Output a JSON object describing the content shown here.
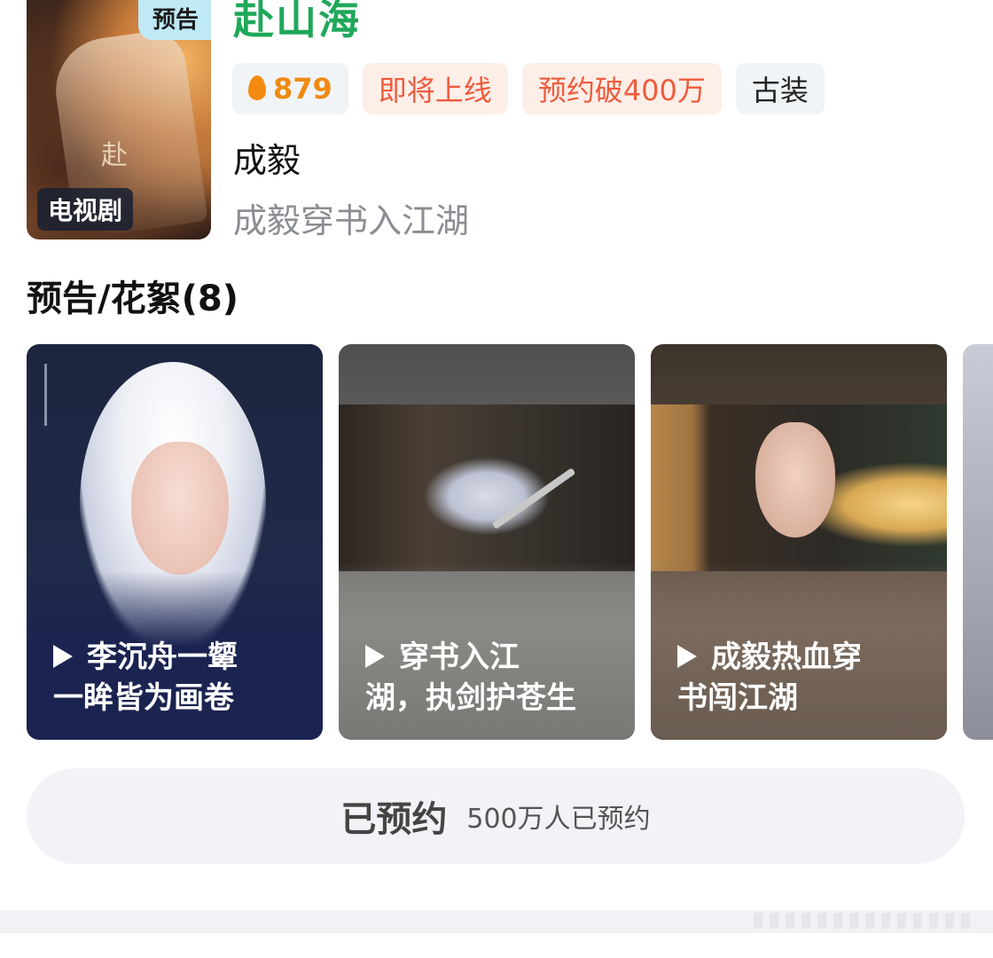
{
  "show": {
    "title": "赴山海",
    "poster_badge": "预告",
    "poster_type": "电视剧",
    "hot_value": "879",
    "tags": [
      "即将上线",
      "预约破400万",
      "古装"
    ],
    "actor": "成毅",
    "description": "成毅穿书入江湖"
  },
  "section": {
    "title": "预告/花絮(8)",
    "cards": [
      {
        "line1": "李沉舟一颦",
        "line2": "一眸皆为画卷"
      },
      {
        "line1": "穿书入江",
        "line2": "湖，执剑护苍生"
      },
      {
        "line1": "成毅热血穿",
        "line2": "书闯江湖"
      }
    ]
  },
  "reserve": {
    "label": "已预约",
    "count_text": "500万人已预约"
  },
  "colors": {
    "title_green": "#1fa85a",
    "hot_orange": "#f08a12",
    "tag_red": "#ee5c3c",
    "tag_red_bg": "#fdeee8",
    "button_bg": "#f1f3f6"
  },
  "icons": {
    "hot": "flame-icon",
    "play": "play-icon"
  }
}
